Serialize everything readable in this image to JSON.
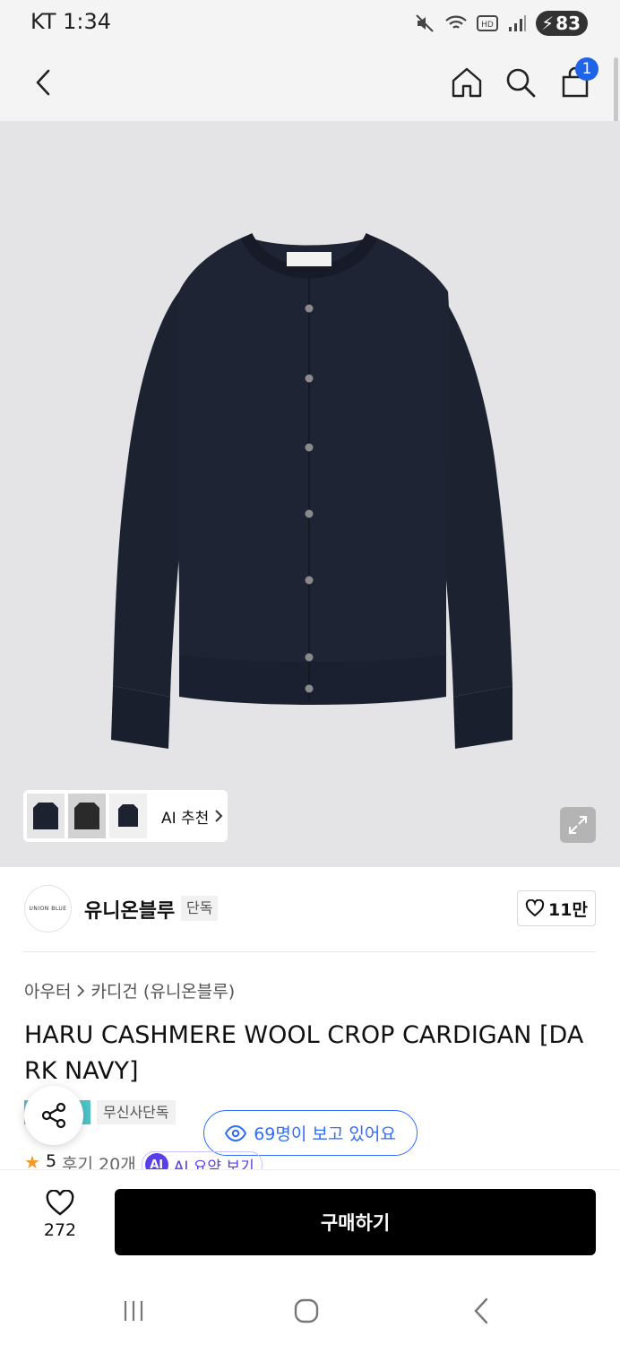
{
  "status_bar": {
    "carrier_time": "KT 1:34",
    "battery": "83"
  },
  "header": {
    "cart_count": "1"
  },
  "gallery": {
    "thumbnails": [
      "cardigan-navy",
      "cardigan-charcoal",
      "cardigan-navy-small"
    ],
    "ai_recommend_label": "AI 추천"
  },
  "brand": {
    "logo_text": "UNION BLUE",
    "name": "유니온블루",
    "exclusive_tag": "단독",
    "likes": "11만"
  },
  "breadcrumb": {
    "category": "아우터",
    "subcategory": "카디건 (유니온블루)"
  },
  "product": {
    "title": "HARU CASHMERE WOOL CROP CARDIGAN [DARK NAVY]",
    "tag_musinsa": "무신사단독",
    "viewers": "69명이 보고 있어요",
    "rating": "5",
    "reviews": "후기 20개",
    "ai_badge": "AI",
    "ai_summary": "AI 요약 보기"
  },
  "bottom": {
    "like_count": "272",
    "buy_label": "구매하기"
  },
  "colors": {
    "accent_blue": "#2f6bff",
    "badge_blue": "#1f63e6",
    "ai_purple": "#5b3de8",
    "garment_navy": "#1c2230"
  }
}
